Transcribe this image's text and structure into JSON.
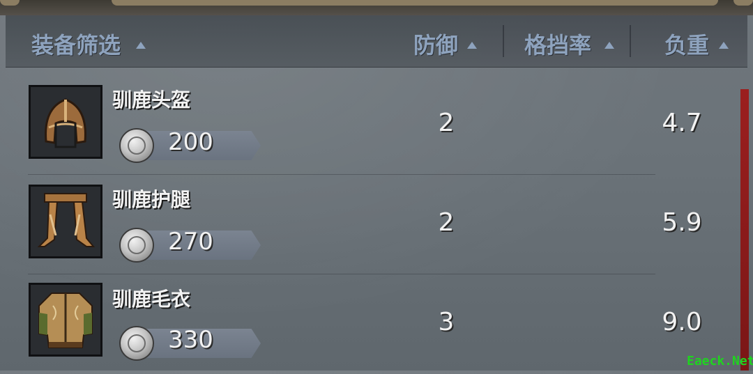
{
  "header": {
    "filter_label": "装备筛选",
    "defense_label": "防御",
    "block_rate_label": "格挡率",
    "weight_label": "负重"
  },
  "items": [
    {
      "name": "驯鹿头盔",
      "price": "200",
      "defense": "2",
      "weight": "4.7",
      "icon": "helmet-icon"
    },
    {
      "name": "驯鹿护腿",
      "price": "270",
      "defense": "2",
      "weight": "5.9",
      "icon": "greaves-icon"
    },
    {
      "name": "驯鹿毛衣",
      "price": "330",
      "defense": "3",
      "weight": "9.0",
      "icon": "sweater-icon"
    }
  ],
  "watermark": "Eaeck.Net",
  "colors": {
    "header_text": "#8ea3be",
    "scrollbar": "#9b1f1f",
    "watermark": "#1fd41f"
  }
}
